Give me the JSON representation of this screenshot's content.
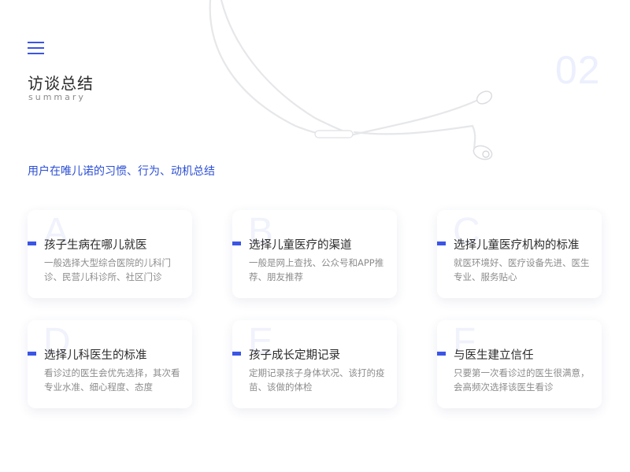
{
  "header": {
    "title": "访谈总结",
    "subtitle": "summary",
    "page_number": "02"
  },
  "section_heading": "用户在唯儿诺的习惯、行为、动机总结",
  "cards": [
    {
      "letter": "A",
      "title": "孩子生病在哪儿就医",
      "desc": "一般选择大型综合医院的儿科门诊、民营儿科诊所、社区门诊"
    },
    {
      "letter": "B",
      "title": "选择儿童医疗的渠道",
      "desc": "一般是网上查找、公众号和APP推荐、朋友推荐"
    },
    {
      "letter": "C",
      "title": "选择儿童医疗机构的标准",
      "desc": "就医环境好、医疗设备先进、医生专业、服务贴心"
    },
    {
      "letter": "D",
      "title": "选择儿科医生的标准",
      "desc": "看诊过的医生会优先选择，其次看专业水准、细心程度、态度"
    },
    {
      "letter": "E",
      "title": "孩子成长定期记录",
      "desc": "定期记录孩子身体状况、该打的疫苗、该做的体检"
    },
    {
      "letter": "F",
      "title": "与医生建立信任",
      "desc": "只要第一次看诊过的医生很满意，会高频次选择该医生看诊"
    }
  ],
  "colors": {
    "accent": "#3b55e6",
    "heading": "#2c4fd6",
    "muted": "#8c8c8c",
    "watermark": "#eceffd"
  },
  "icons": {
    "menu": "menu-icon",
    "decoration": "earphone-illustration"
  }
}
